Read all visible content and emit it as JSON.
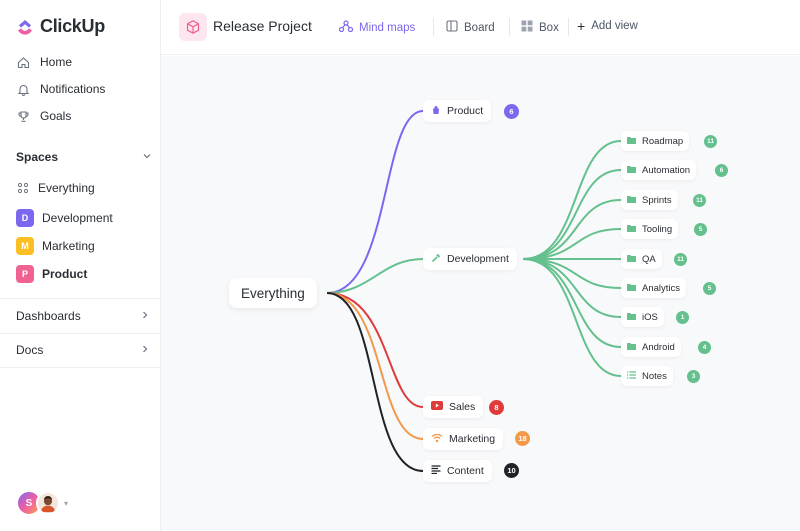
{
  "app": {
    "name": "ClickUp",
    "logo_colors": [
      "#7b68ee",
      "#f05fa5",
      "#fd9c4d"
    ]
  },
  "sidebar": {
    "nav": [
      {
        "label": "Home",
        "icon": "home-icon"
      },
      {
        "label": "Notifications",
        "icon": "bell-icon"
      },
      {
        "label": "Goals",
        "icon": "trophy-icon"
      }
    ],
    "spaces_title": "Spaces",
    "spaces": [
      {
        "label": "Everything",
        "icon": "grid-icon"
      },
      {
        "label": "Development",
        "badge": "D",
        "color": "#7b68ee"
      },
      {
        "label": "Marketing",
        "badge": "M",
        "color": "#fbbf24"
      },
      {
        "label": "Product",
        "badge": "P",
        "color": "#f06292"
      }
    ],
    "dashboards": "Dashboards",
    "docs": "Docs",
    "avatar_initial": "S"
  },
  "header": {
    "project_title": "Release Project",
    "views": [
      {
        "label": "Mind maps",
        "icon": "mindmap-icon",
        "active": true
      },
      {
        "label": "Board",
        "icon": "board-icon"
      },
      {
        "label": "Box",
        "icon": "box-icon"
      },
      {
        "label": "Add view",
        "icon": "plus-icon"
      }
    ]
  },
  "mindmap": {
    "root": "Everything",
    "branches": [
      {
        "label": "Product",
        "count": "6",
        "color": "#7b68ee",
        "icon": "bag-icon"
      },
      {
        "label": "Development",
        "color": "#64c08d",
        "icon": "hammer-icon"
      },
      {
        "label": "Sales",
        "count": "8",
        "color": "#e03b3b",
        "icon": "youtube-icon"
      },
      {
        "label": "Marketing",
        "count": "18",
        "color": "#f2994a",
        "icon": "wifi-icon"
      },
      {
        "label": "Content",
        "count": "10",
        "color": "#1f2328",
        "icon": "lines-icon"
      }
    ],
    "dev_children": [
      {
        "label": "Roadmap",
        "count": "11"
      },
      {
        "label": "Automation",
        "count": "6"
      },
      {
        "label": "Sprints",
        "count": "11"
      },
      {
        "label": "Tooling",
        "count": "5"
      },
      {
        "label": "QA",
        "count": "11"
      },
      {
        "label": "Analytics",
        "count": "5"
      },
      {
        "label": "iOS",
        "count": "1"
      },
      {
        "label": "Android",
        "count": "4"
      },
      {
        "label": "Notes",
        "count": "3"
      }
    ],
    "dev_color": "#64c08d"
  }
}
